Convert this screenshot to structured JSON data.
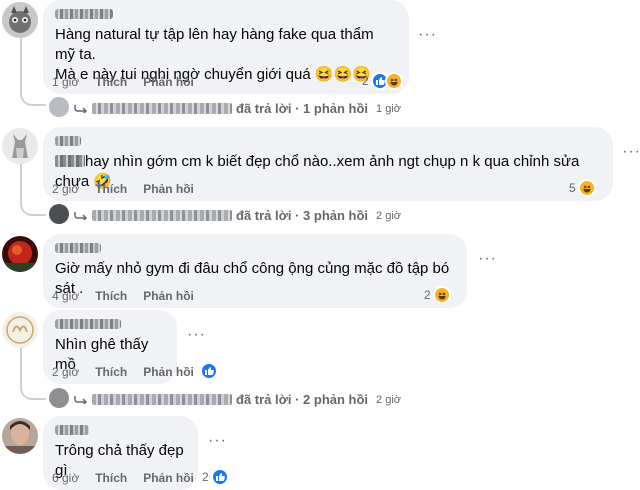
{
  "comments": [
    {
      "text": "Hàng natural tự tập lên hay hàng fake qua thẩm mỹ ta.\nMà e này tui nghi ngờ chuyển giới quá 😆😆😆",
      "time": "1 giờ",
      "like": "Thích",
      "reply": "Phản hồi",
      "reaction_count": "2",
      "reactions": [
        "like-icon",
        "haha-icon"
      ],
      "replies": {
        "label": "đã trả lời · 1 phản hồi",
        "time": "1 giờ"
      }
    },
    {
      "text_prefix_blurred": true,
      "text": "hay nhìn gớm cm k biết đẹp chổ nào..xem ảnh ngt chụp n k qua chỉnh sửa chưa 🤣",
      "time": "2 giờ",
      "like": "Thích",
      "reply": "Phản hồi",
      "reaction_count": "5",
      "reactions": [
        "haha-icon"
      ],
      "replies": {
        "label": "đã trả lời · 3 phản hồi",
        "time": "2 giờ"
      }
    },
    {
      "text": "Giờ mấy nhỏ gym đi đâu chổ công ộng củng mặc đồ tập bó sát .",
      "time": "4 giờ",
      "like": "Thích",
      "reply": "Phản hồi",
      "reaction_count": "2",
      "reactions": [
        "haha-icon"
      ]
    },
    {
      "text": "Nhìn ghê thấy mồ",
      "time": "2 giờ",
      "like": "Thích",
      "reply": "Phản hồi",
      "reaction_count": "",
      "reactions": [
        "like-icon"
      ],
      "replies": {
        "label": "đã trả lời · 2 phản hồi",
        "time": "2 giờ"
      }
    },
    {
      "text": "Trông chả thấy đẹp gì",
      "time": "6 giờ",
      "like": "Thích",
      "reply": "Phản hồi",
      "reaction_count": "2",
      "reactions": [
        "like-icon"
      ]
    }
  ],
  "more_label": "···",
  "colors": {
    "bubble": "#f0f2f5",
    "meta": "#65676b",
    "like_blue": "#1877f2",
    "haha_yellow": "#f7b125",
    "thread_line": "#ced0d4"
  }
}
